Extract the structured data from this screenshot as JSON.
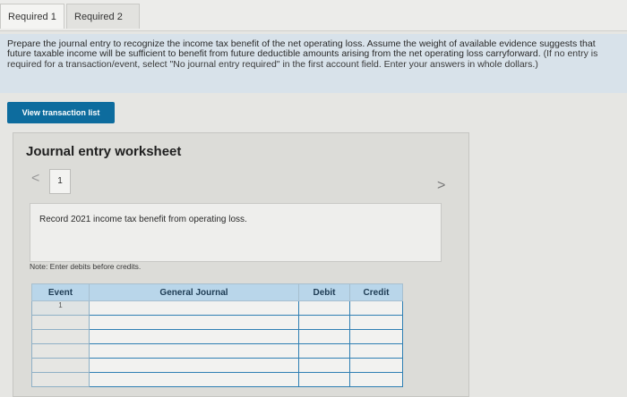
{
  "tabs": [
    {
      "label": "Required 1"
    },
    {
      "label": "Required 2"
    }
  ],
  "instructions": {
    "main": "Prepare the journal entry to recognize the income tax benefit of the net operating loss. Assume the weight of available evidence suggests that future taxable income will be sufficient to benefit from future deductible amounts arising from the net operating loss carryforward.",
    "note": "(If no entry is required for a transaction/event, select \"No journal entry required\" in the first account field. Enter your answers in whole dollars.)"
  },
  "view_button": {
    "label": "View transaction list"
  },
  "worksheet": {
    "title": "Journal entry worksheet",
    "prev_icon": "<",
    "next_icon": ">",
    "page": "1",
    "record_text": "Record 2021 income tax benefit from operating loss.",
    "note": "Note: Enter debits before credits."
  },
  "journal": {
    "headers": [
      "Event",
      "General Journal",
      "Debit",
      "Credit"
    ],
    "event_number": "1"
  }
}
